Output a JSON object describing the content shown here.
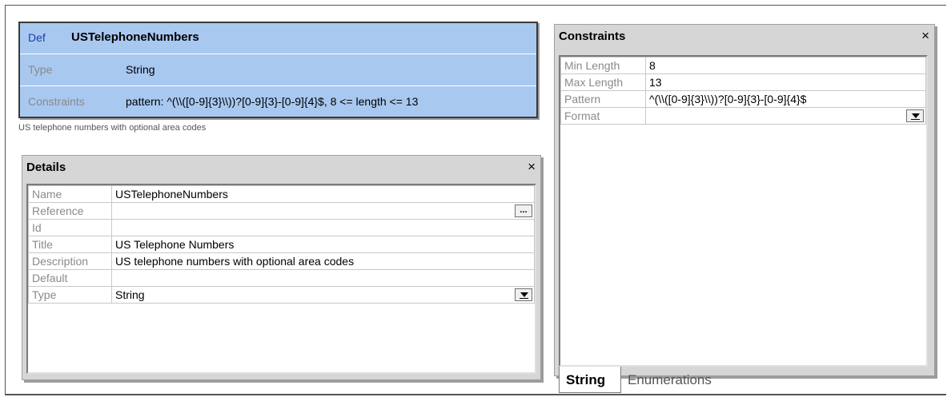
{
  "definition": {
    "keyword": "Def",
    "name": "USTelephoneNumbers",
    "rows": [
      {
        "label": "Type",
        "value": "String"
      },
      {
        "label": "Constraints",
        "value": "pattern: ^(\\\\([0-9]{3}\\\\))?[0-9]{3}-[0-9]{4}$, 8 <= length <= 13"
      }
    ],
    "description": "US telephone numbers with optional area codes"
  },
  "details": {
    "title": "Details",
    "close": "×",
    "rows": [
      {
        "label": "Name",
        "value": "USTelephoneNumbers"
      },
      {
        "label": "Reference",
        "value": "",
        "button": "..."
      },
      {
        "label": "Id",
        "value": ""
      },
      {
        "label": "Title",
        "value": "US Telephone Numbers"
      },
      {
        "label": "Description",
        "value": "US telephone numbers with optional area codes"
      },
      {
        "label": "Default",
        "value": ""
      },
      {
        "label": "Type",
        "value": "String"
      }
    ]
  },
  "constraints": {
    "title": "Constraints",
    "close": "×",
    "rows": [
      {
        "label": "Min Length",
        "value": "8"
      },
      {
        "label": "Max Length",
        "value": "13"
      },
      {
        "label": "Pattern",
        "value": "^(\\\\([0-9]{3}\\\\))?[0-9]{3}-[0-9]{4}$"
      },
      {
        "label": "Format",
        "value": ""
      }
    ],
    "tabs": [
      {
        "label": "String",
        "active": true
      },
      {
        "label": "Enumerations",
        "active": false
      }
    ]
  }
}
